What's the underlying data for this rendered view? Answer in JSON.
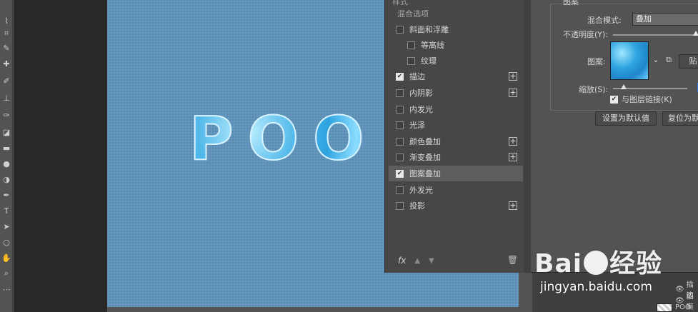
{
  "canvas": {
    "text": "POO"
  },
  "layer_style": {
    "header": "样式",
    "blend_options": "混合选项",
    "items": [
      {
        "label": "斜面和浮雕",
        "checked": false,
        "indent": false,
        "has_plus": false
      },
      {
        "label": "等高线",
        "checked": false,
        "indent": true,
        "has_plus": false
      },
      {
        "label": "纹理",
        "checked": false,
        "indent": true,
        "has_plus": false
      },
      {
        "label": "描边",
        "checked": true,
        "indent": false,
        "has_plus": true
      },
      {
        "label": "内阴影",
        "checked": false,
        "indent": false,
        "has_plus": true
      },
      {
        "label": "内发光",
        "checked": false,
        "indent": false,
        "has_plus": false
      },
      {
        "label": "光泽",
        "checked": false,
        "indent": false,
        "has_plus": false
      },
      {
        "label": "颜色叠加",
        "checked": false,
        "indent": false,
        "has_plus": true
      },
      {
        "label": "渐变叠加",
        "checked": false,
        "indent": false,
        "has_plus": true
      },
      {
        "label": "图案叠加",
        "checked": true,
        "indent": false,
        "has_plus": false,
        "active": true
      },
      {
        "label": "外发光",
        "checked": false,
        "indent": false,
        "has_plus": false
      },
      {
        "label": "投影",
        "checked": false,
        "indent": false,
        "has_plus": true
      }
    ],
    "footer": {
      "fx": "fx"
    }
  },
  "pattern_settings": {
    "group_label": "图案",
    "blend_mode_label": "混合模式:",
    "blend_mode_value": "叠加",
    "opacity_label": "不透明度(Y):",
    "opacity_value": "100",
    "opacity_level": 100,
    "pattern_label": "图案:",
    "snap_button": "贴",
    "scale_label": "缩放(S):",
    "scale_value": "39",
    "link_label": "与图层链接(K)",
    "link_checked": true,
    "default_button": "设置为默认值",
    "reset_button": "复位为默"
  },
  "layers_panel": {
    "row1": "描边",
    "row2": "图案",
    "layer_name": "POO"
  },
  "watermark": {
    "logo_left": "Bai",
    "logo_right": "经验",
    "url": "jingyan.baidu.com"
  },
  "colors": {
    "canvas_bg": "#5f93bb",
    "panel_bg": "#535353",
    "list_bg": "#474747",
    "highlight": "#2f6fd6"
  }
}
